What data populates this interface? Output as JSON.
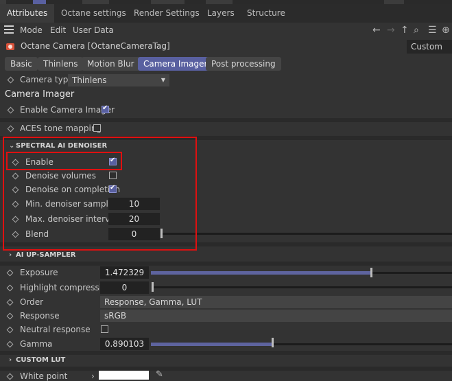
{
  "tabs": [
    "Attributes",
    "Octane settings",
    "Render Settings",
    "Layers",
    "Structure"
  ],
  "menu": {
    "mode": "Mode",
    "edit": "Edit",
    "user_data": "User Data"
  },
  "nav_icons": [
    "arrow-left-icon",
    "arrow-right-icon",
    "arrow-up-icon",
    "search-icon",
    "filter-icon",
    "plus-icon"
  ],
  "object": {
    "title": "Octane Camera [OctaneCameraTag]",
    "preset": "Custom"
  },
  "subtabs": [
    "Basic",
    "Thinlens",
    "Motion Blur",
    "Camera Imager",
    "Post processing"
  ],
  "camera_type": {
    "label": "Camera type",
    "value": "Thinlens"
  },
  "section_title": "Camera Imager",
  "enable_imager": {
    "label": "Enable Camera Imager",
    "checked": true
  },
  "aces": {
    "label": "ACES tone mapping",
    "checked": false
  },
  "denoiser": {
    "header": "SPECTRAL AI DENOISER",
    "enable": {
      "label": "Enable",
      "checked": true
    },
    "volumes": {
      "label": "Denoise volumes",
      "checked": false
    },
    "on_completion": {
      "label": "Denoise on completion",
      "checked": true
    },
    "min_samples": {
      "label": "Min. denoiser samples",
      "value": "10"
    },
    "max_interval": {
      "label": "Max. denoiser interval",
      "value": "20"
    },
    "blend": {
      "label": "Blend",
      "value": "0",
      "level": 0.0
    }
  },
  "upsampler": {
    "header": "AI UP-SAMPLER"
  },
  "exposure": {
    "label": "Exposure",
    "value": "1.472329",
    "level": 0.73
  },
  "highlight": {
    "label": "Highlight compression",
    "value": "0",
    "level": 0.0
  },
  "order": {
    "label": "Order",
    "value": "Response, Gamma, LUT"
  },
  "response": {
    "label": "Response",
    "value": "sRGB"
  },
  "neutral": {
    "label": "Neutral response",
    "checked": false
  },
  "gamma": {
    "label": "Gamma",
    "value": "0.890103",
    "level": 0.4
  },
  "custom_lut": {
    "header": "CUSTOM LUT"
  },
  "white_point": {
    "label": "White point"
  },
  "colors": {
    "accent": "#5960a0",
    "highlight_box": "#e01010"
  }
}
